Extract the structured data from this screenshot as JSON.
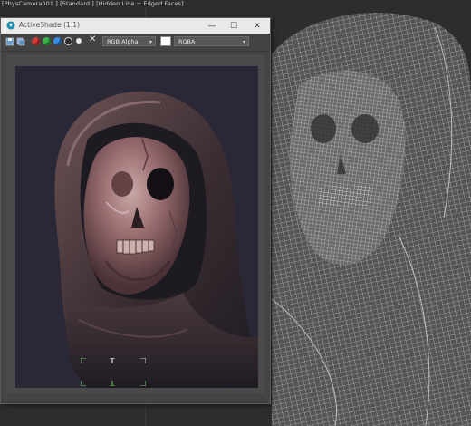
{
  "viewport": {
    "label": "[PhysCamera001 ] [Standard ] [Hidden Line + Edged Faces]",
    "colors": {
      "background": "#2d2d2d",
      "wireframe": "#cfcfcf"
    }
  },
  "active_shade": {
    "title": "ActiveShade (1:1)",
    "window_buttons": {
      "minimize": "—",
      "maximize": "☐",
      "close": "✕"
    },
    "toolbar": {
      "channel_dropdown": "RGB Alpha",
      "display_dropdown": "RGBA",
      "dropdown_arrow": "▾",
      "clear_symbol": "✕",
      "icons": [
        "save-icon",
        "copy-icon",
        "red-channel-icon",
        "green-channel-icon",
        "blue-channel-icon",
        "alpha-channel-icon",
        "monochrome-icon",
        "clear-icon"
      ]
    },
    "colors": {
      "titlebar": "#e9e9e9",
      "window": "#444444",
      "render_bg": "#2a2837"
    }
  }
}
